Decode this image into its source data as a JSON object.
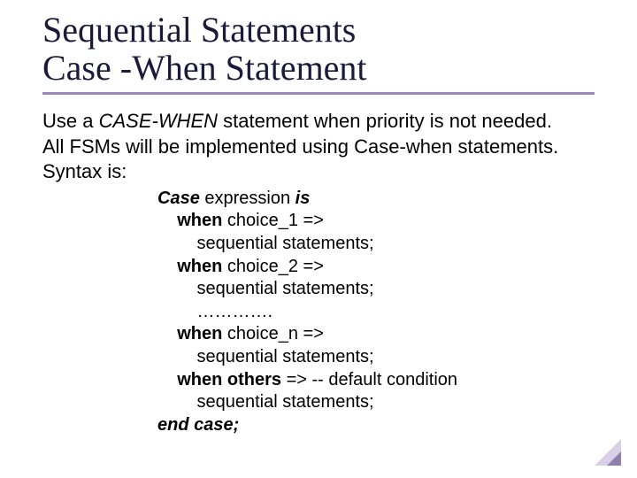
{
  "title": {
    "line1": "Sequential Statements",
    "line2": "Case -When Statement"
  },
  "intro": {
    "use_a": "Use a ",
    "case_when": "CASE-WHEN",
    "rest1": " statement when priority is not needed.",
    "line2": "All FSMs will be implemented using Case-when statements.",
    "line3": "Syntax is:"
  },
  "code": {
    "l1_kw1": "Case",
    "l1_mid": " expression ",
    "l1_kw2": "is",
    "l2_kw": "    when",
    "l2_rest": " choice_1 =>",
    "l3": "        sequential statements;",
    "l4_kw": "    when",
    "l4_rest": " choice_2 =>",
    "l5": "        sequential statements;",
    "l6": "        ………….",
    "l7_kw": "    when",
    "l7_rest": " choice_n =>",
    "l8": "        sequential statements;",
    "l9_kw": "    when others",
    "l9_rest": " => -- default condition",
    "l10": "        sequential statements;",
    "l11": "end case;"
  }
}
